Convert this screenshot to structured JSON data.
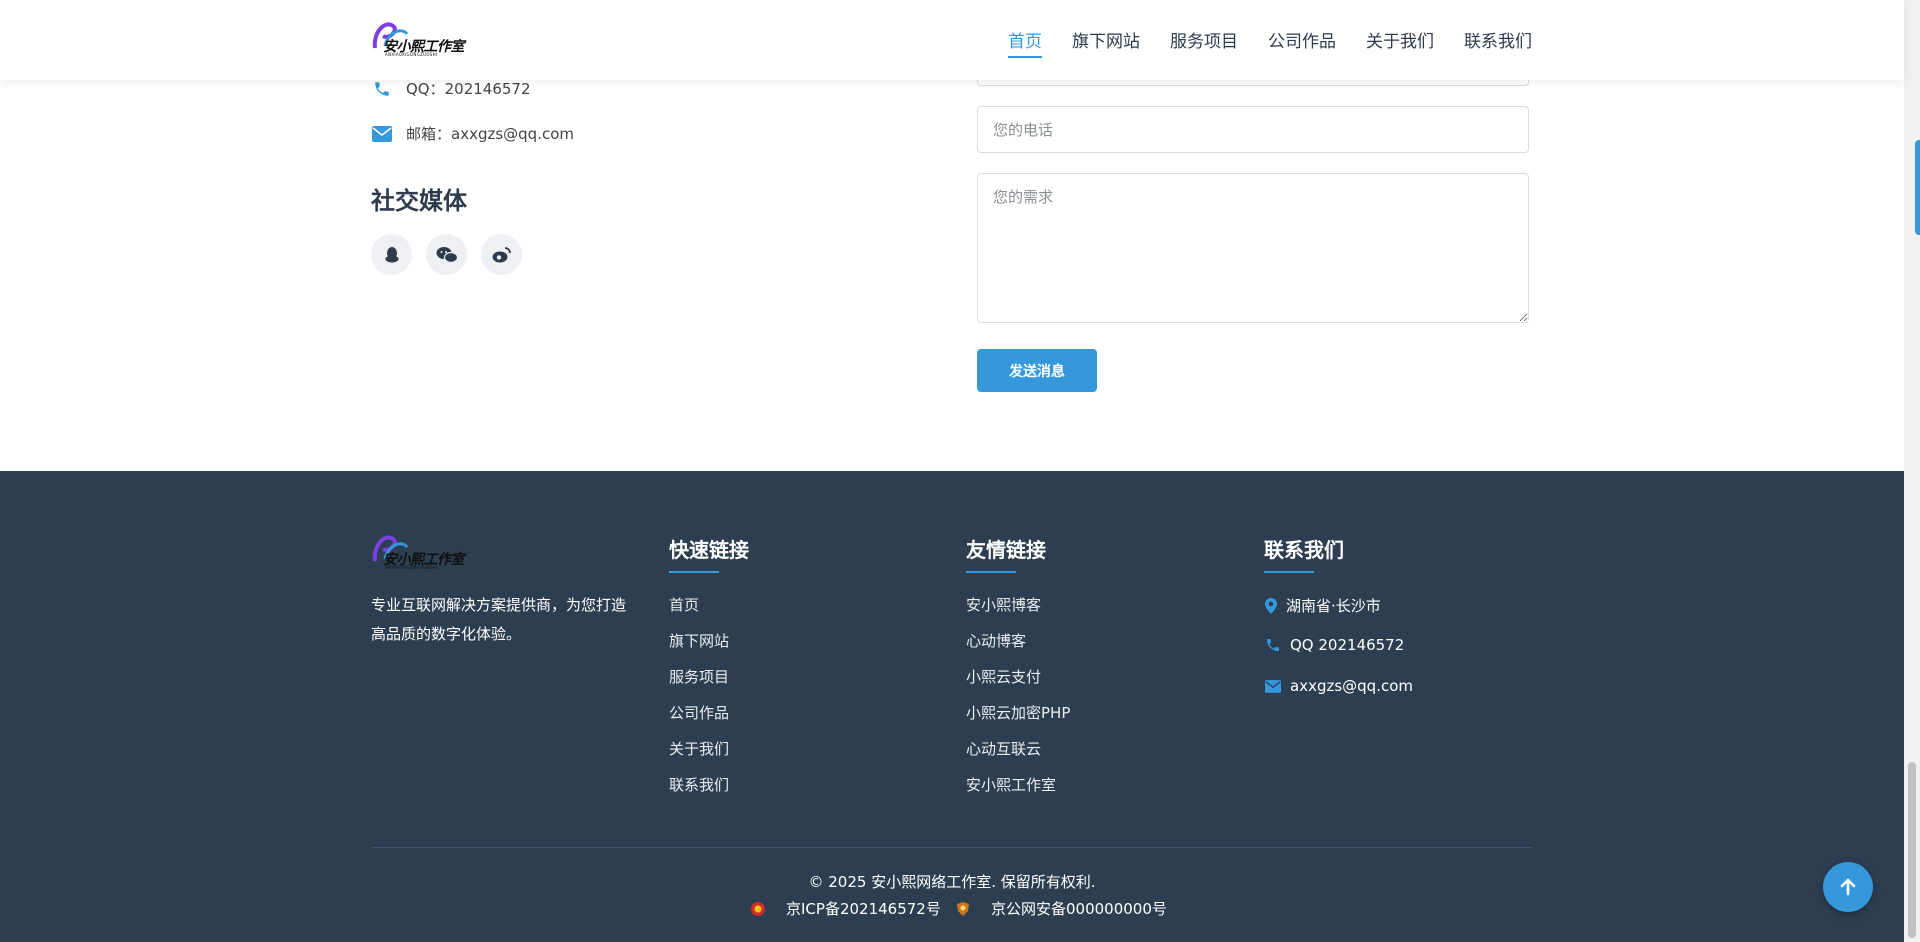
{
  "header": {
    "logo_text": "安小熙工作室",
    "logo_sub": "ANXIAOXIGONGZUOSHI",
    "nav": [
      "首页",
      "旗下网站",
      "服务项目",
      "公司作品",
      "关于我们",
      "联系我们"
    ],
    "active_index": 0
  },
  "contact": {
    "qq": "QQ：202146572",
    "email": "邮箱：axxgzs@qq.com",
    "social_title": "社交媒体",
    "social_icons": [
      "qq-icon",
      "wechat-icon",
      "weibo-icon"
    ]
  },
  "form": {
    "phone_placeholder": "您的电话",
    "message_placeholder": "您的需求",
    "send_label": "发送消息"
  },
  "footer": {
    "description": "专业互联网解决方案提供商，为您打造高品质的数字化体验。",
    "quick_links_title": "快速链接",
    "quick_links": [
      "首页",
      "旗下网站",
      "服务项目",
      "公司作品",
      "关于我们",
      "联系我们"
    ],
    "friend_links_title": "友情链接",
    "friend_links": [
      "安小熙博客",
      "心动博客",
      "小熙云支付",
      "小熙云加密PHP",
      "心动互联云",
      "安小熙工作室"
    ],
    "contact_title": "联系我们",
    "address": "湖南省·长沙市",
    "qq": "QQ 202146572",
    "email": "axxgzs@qq.com",
    "copyright": "© 2025 安小熙网络工作室. 保留所有权利.",
    "icp": "京ICP备202146572号",
    "police": "京公网安备000000000号"
  },
  "colors": {
    "accent": "#3498db",
    "footer_bg": "#2c3e50",
    "heading": "#2d3b4d"
  }
}
